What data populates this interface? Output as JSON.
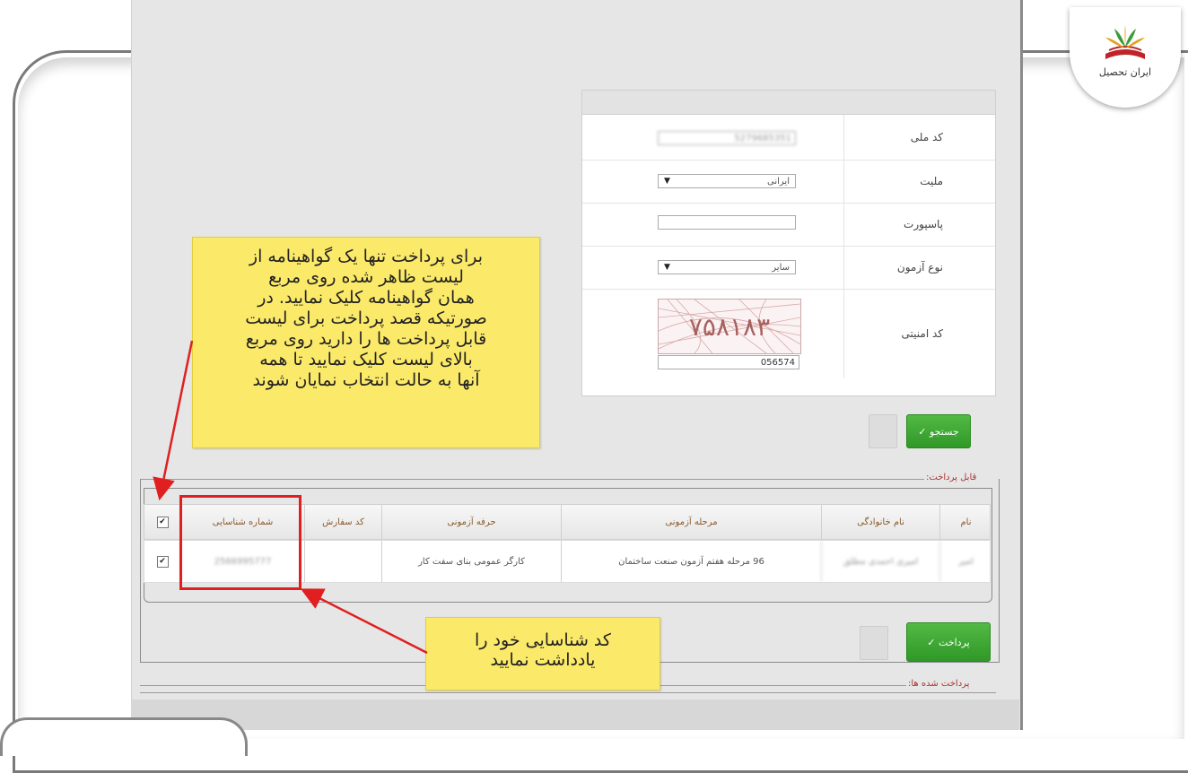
{
  "logo": {
    "text": "ایران تحصیل",
    "icon": "book-leaves-icon"
  },
  "form": {
    "fields": [
      {
        "label": "کد ملی",
        "value": "5279685351",
        "type": "text"
      },
      {
        "label": "ملیت",
        "value": "ایرانی",
        "type": "select"
      },
      {
        "label": "پاسپورت",
        "value": "",
        "type": "text"
      },
      {
        "label": "نوع آزمون",
        "value": "سایر",
        "type": "select"
      },
      {
        "label": "کد امنیتی",
        "value": "056574",
        "type": "captcha",
        "captcha_text": "۷۵۸۱۸۳"
      }
    ]
  },
  "buttons": {
    "search": "جستجو ✓",
    "pay": "پرداخت ✓"
  },
  "sections": {
    "payable": "قابل پرداخت:",
    "paid": "پرداخت شده ها:"
  },
  "table": {
    "headers": [
      "نام",
      "نام خانوادگی",
      "مرحله آزمونی",
      "حرفه آزمونی",
      "کد سفارش",
      "شماره شناسایی"
    ],
    "rows": [
      {
        "name": "امیر",
        "family": "امیری احمدی مطلق",
        "stage": "96 مرحله هفتم آزمون صنعت ساختمان",
        "profession": "کارگر عمومی بنای سفت کار",
        "order": "",
        "id_number": "2566995777",
        "checked": true
      }
    ],
    "header_checked": true
  },
  "notes": {
    "note1": [
      "برای پرداخت تنها یک گواهینامه از",
      "لیست ظاهر شده روی مربع",
      "همان گواهینامه کلیک نمایید. در",
      "صورتیکه قصد پرداخت برای لیست",
      "قابل پرداخت ها را دارید روی مربع",
      "بالای لیست کلیک نمایید تا همه",
      "آنها به حالت انتخاب نمایان شوند"
    ],
    "note2": [
      "کد شناسایی خود را",
      "یادداشت نمایید"
    ]
  },
  "colors": {
    "accent_green": "#3aa52f",
    "note_yellow": "#fbe96a",
    "highlight_red": "#e02020"
  }
}
